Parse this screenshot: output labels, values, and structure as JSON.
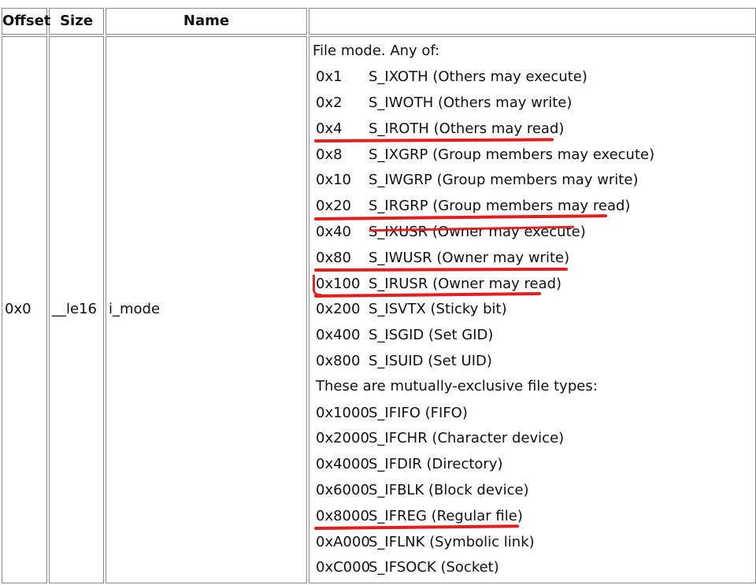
{
  "table": {
    "headers": {
      "offset": "Offset",
      "size": "Size",
      "name": "Name",
      "description": ""
    },
    "row": {
      "offset": "0x0",
      "size": "__le16",
      "name": "i_mode"
    },
    "description": {
      "intro": "File mode. Any of:",
      "mode_flags": [
        {
          "value": "0x1",
          "label": "S_IXOTH (Others may execute)",
          "highlighted": false
        },
        {
          "value": "0x2",
          "label": "S_IWOTH (Others may write)",
          "highlighted": false
        },
        {
          "value": "0x4",
          "label": "S_IROTH (Others may read)",
          "highlighted": true
        },
        {
          "value": "0x8",
          "label": "S_IXGRP (Group members may execute)",
          "highlighted": false
        },
        {
          "value": "0x10",
          "label": "S_IWGRP (Group members may write)",
          "highlighted": false
        },
        {
          "value": "0x20",
          "label": "S_IRGRP (Group members may read)",
          "highlighted": true
        },
        {
          "value": "0x40",
          "label": "S_IXUSR (Owner may execute)",
          "highlighted": false
        },
        {
          "value": "0x80",
          "label": "S_IWUSR (Owner may write)",
          "highlighted": true
        },
        {
          "value": "0x100",
          "label": "S_IRUSR (Owner may read)",
          "highlighted": true
        },
        {
          "value": "0x200",
          "label": "S_ISVTX (Sticky bit)",
          "highlighted": false
        },
        {
          "value": "0x400",
          "label": "S_ISGID (Set GID)",
          "highlighted": false
        },
        {
          "value": "0x800",
          "label": "S_ISUID (Set UID)",
          "highlighted": false
        }
      ],
      "types_heading": "These are mutually-exclusive file types:",
      "file_types": [
        {
          "value": "0x1000",
          "label": "S_IFIFO (FIFO)",
          "highlighted": false
        },
        {
          "value": "0x2000",
          "label": "S_IFCHR (Character device)",
          "highlighted": false
        },
        {
          "value": "0x4000",
          "label": "S_IFDIR (Directory)",
          "highlighted": false
        },
        {
          "value": "0x6000",
          "label": "S_IFBLK (Block device)",
          "highlighted": false
        },
        {
          "value": "0x8000",
          "label": "S_IFREG (Regular file)",
          "highlighted": true
        },
        {
          "value": "0xA000",
          "label": "S_IFLNK (Symbolic link)",
          "highlighted": false
        },
        {
          "value": "0xC000",
          "label": "S_IFSOCK (Socket)",
          "highlighted": false
        }
      ]
    }
  },
  "annotation": {
    "color": "#e11a1a"
  }
}
